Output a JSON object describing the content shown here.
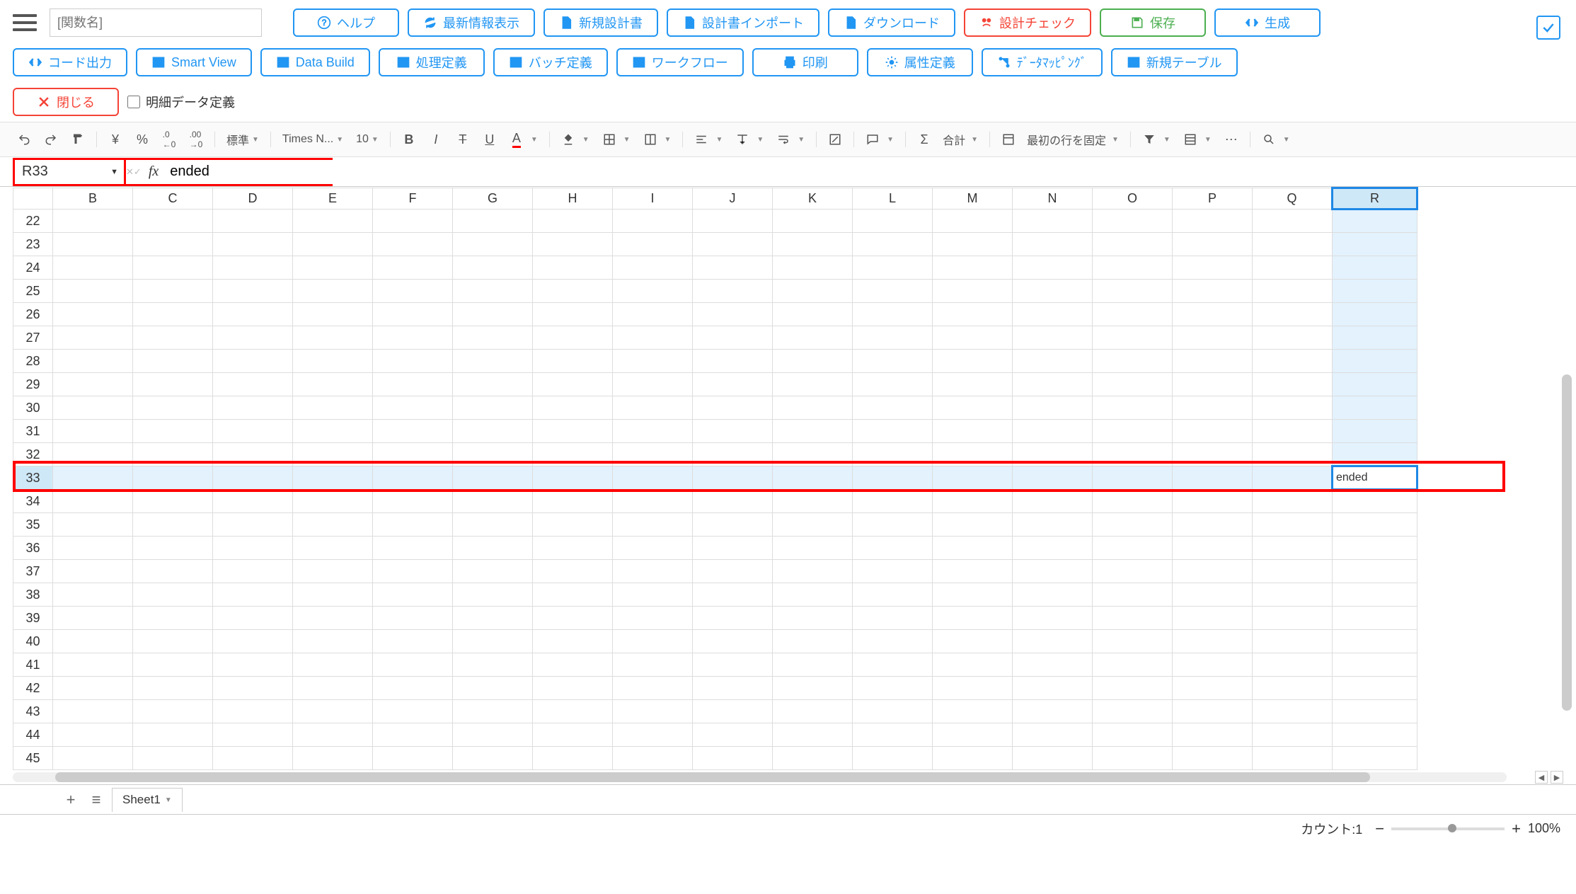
{
  "header": {
    "func_name_placeholder": "[関数名]",
    "buttons": {
      "help": "ヘルプ",
      "refresh": "最新情報表示",
      "new_design": "新規設計書",
      "import_design": "設計書インポート",
      "download": "ダウンロード",
      "design_check": "設計チェック",
      "save": "保存",
      "generate": "生成"
    }
  },
  "row2": {
    "code_output": "コード出力",
    "smart_view": "Smart View",
    "data_build": "Data Build",
    "process_def": "処理定義",
    "batch_def": "バッチ定義",
    "workflow": "ワークフロー",
    "print": "印刷",
    "attr_def": "属性定義",
    "data_mapping": "ﾃﾞｰﾀﾏｯﾋﾟﾝｸﾞ",
    "new_table": "新規テーブル"
  },
  "row3": {
    "close": "閉じる",
    "detail_check_label": "明細データ定義"
  },
  "fmt": {
    "currency": "¥",
    "percent": "%",
    "inc_dec1": ".0",
    "inc_dec2": ".00",
    "format_style": "標準",
    "font_name": "Times N...",
    "font_size": "10",
    "sum_label": "合計",
    "freeze_label": "最初の行を固定"
  },
  "formula": {
    "cell_ref": "R33",
    "value": "ended"
  },
  "columns": [
    "B",
    "C",
    "D",
    "E",
    "F",
    "G",
    "H",
    "I",
    "J",
    "K",
    "L",
    "M",
    "N",
    "O",
    "P",
    "Q",
    "R"
  ],
  "rows": [
    22,
    23,
    24,
    25,
    26,
    27,
    28,
    29,
    30,
    31,
    32,
    33,
    34,
    35,
    36,
    37,
    38,
    39,
    40,
    41,
    42,
    43,
    44,
    45
  ],
  "active_cell": {
    "row": 33,
    "col": "R",
    "value": "ended"
  },
  "sheet": {
    "name": "Sheet1"
  },
  "status": {
    "count_label": "カウント:1",
    "zoom": "100%"
  }
}
